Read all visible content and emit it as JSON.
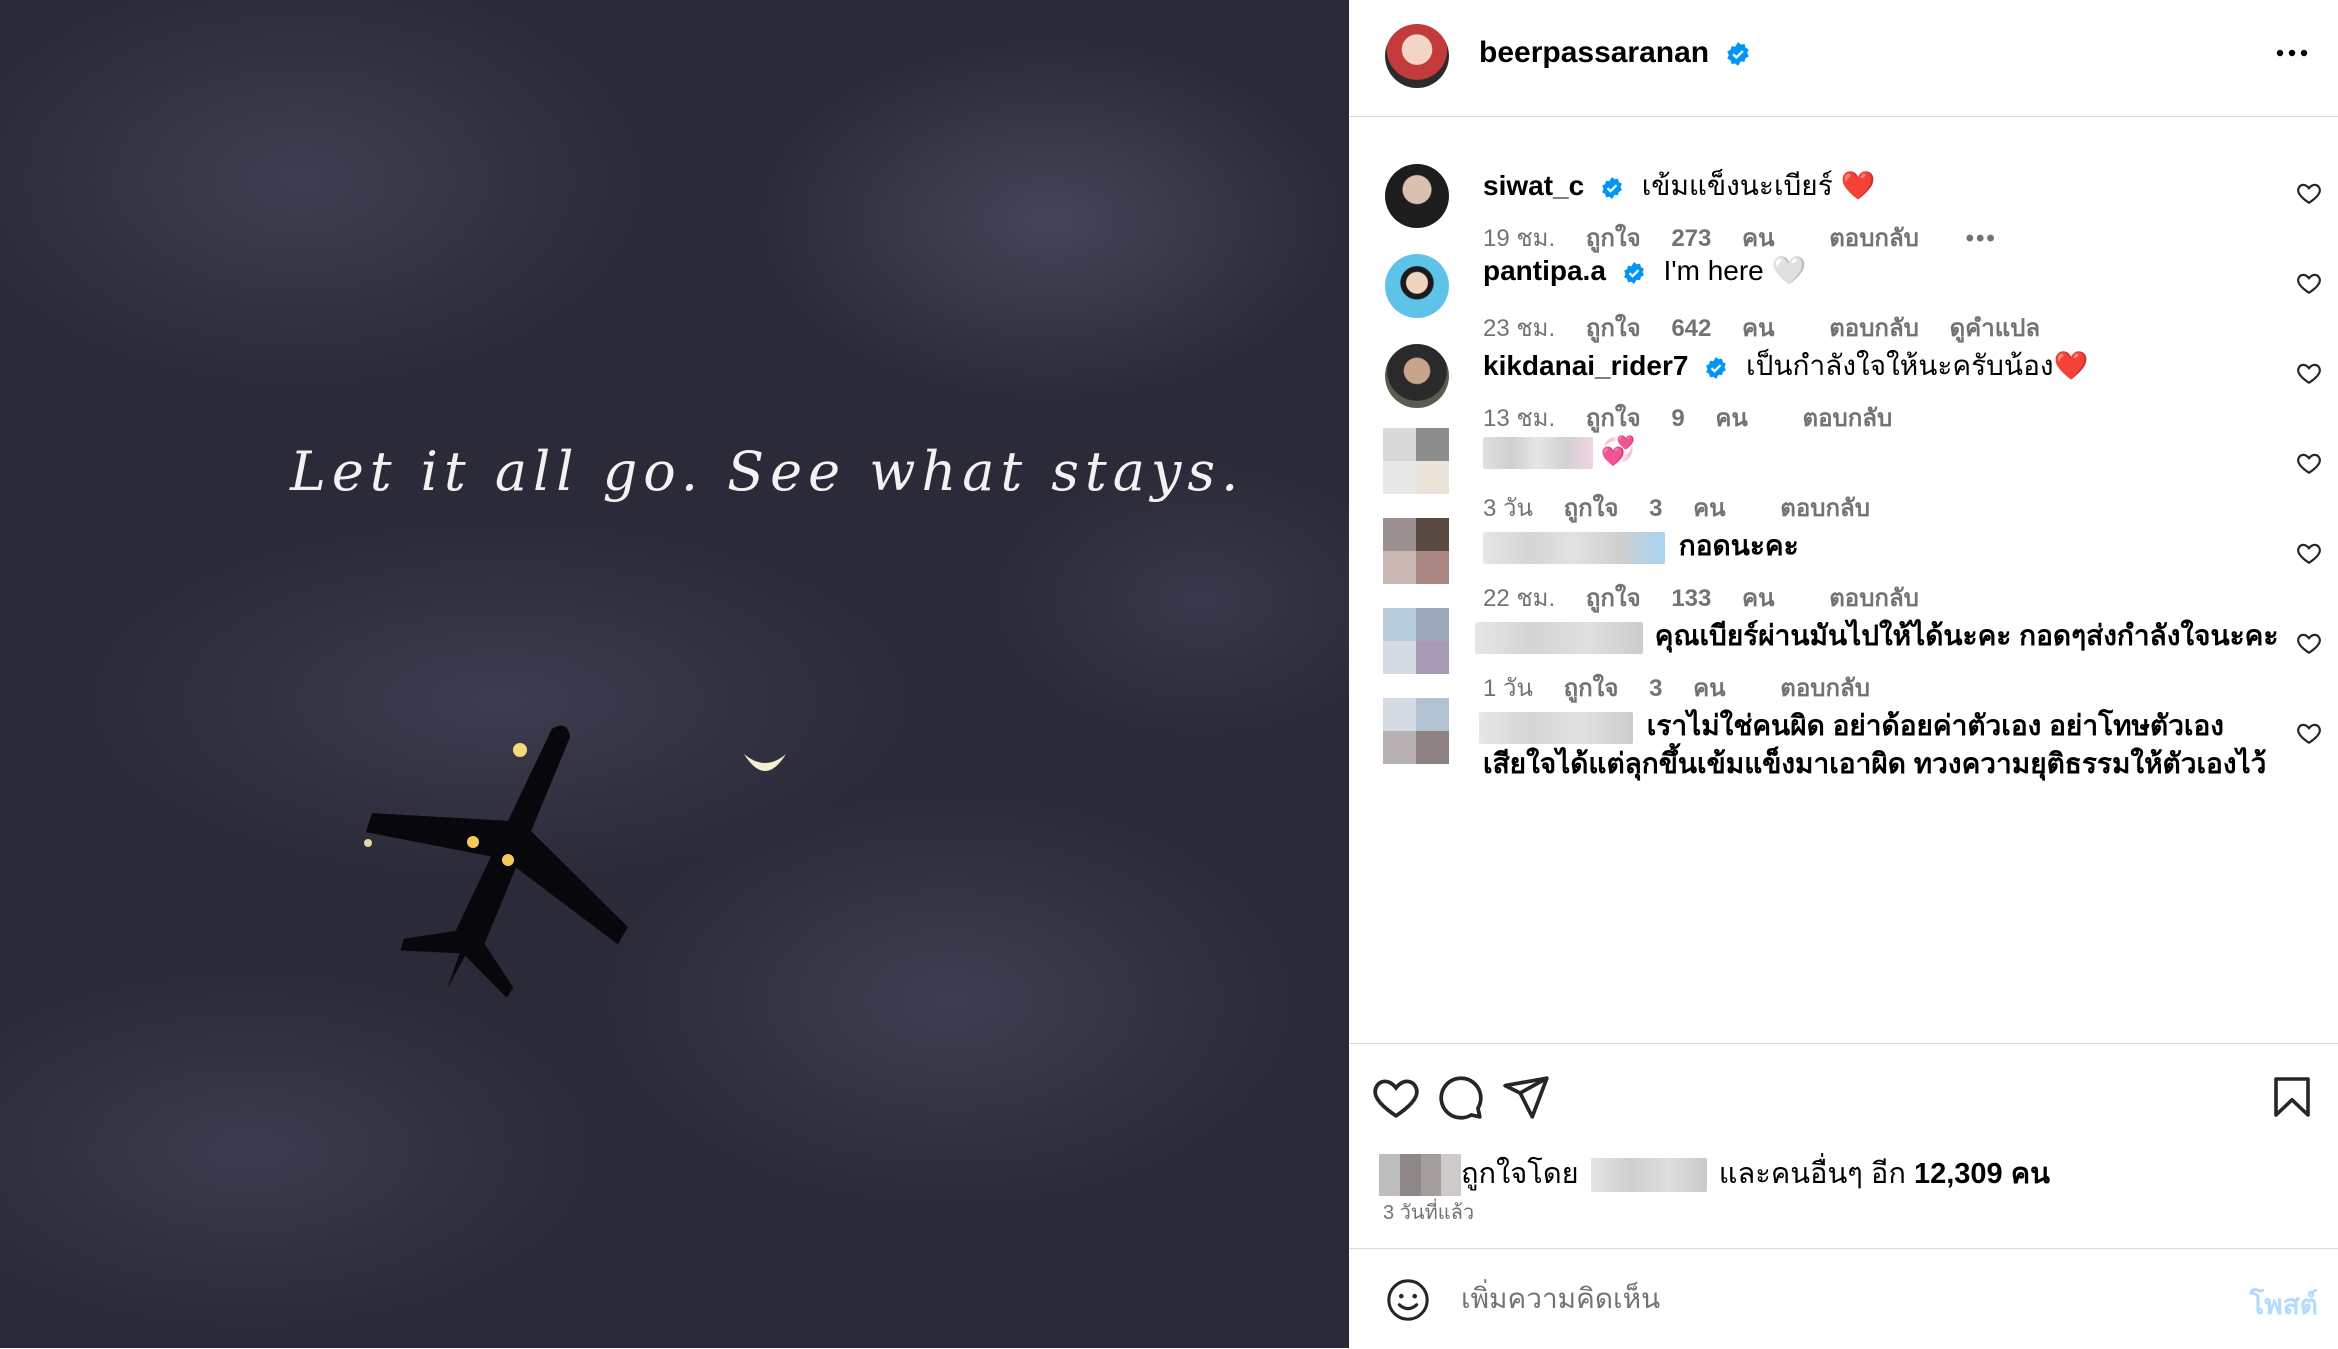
{
  "photo": {
    "caption": "Let it all go. See what stays."
  },
  "header": {
    "username": "beerpassaranan",
    "more_icon": "more-horizontal-icon"
  },
  "comments": [
    {
      "username": "siwat_c",
      "verified": true,
      "text": "เข้มแข็งนะเบียร์ ❤️",
      "time": "19 ชม.",
      "likes_prefix": "ถูกใจ",
      "likes": "273",
      "likes_suffix": "คน",
      "reply": "ตอบกลับ",
      "extra": "•••"
    },
    {
      "username": "pantipa.a",
      "verified": true,
      "text": "I'm here 🤍",
      "time": "23 ชม.",
      "likes_prefix": "ถูกใจ",
      "likes": "642",
      "likes_suffix": "คน",
      "reply": "ตอบกลับ",
      "extra": "ดูคำแปล"
    },
    {
      "username": "kikdanai_rider7",
      "verified": true,
      "text": "เป็นกำลังใจให้นะครับน้อง❤️",
      "time": "13 ชม.",
      "likes_prefix": "ถูกใจ",
      "likes": "9",
      "likes_suffix": "คน",
      "reply": "ตอบกลับ"
    },
    {
      "username": "",
      "text": "💞",
      "time": "3 วัน",
      "likes_prefix": "ถูกใจ",
      "likes": "3",
      "likes_suffix": "คน",
      "reply": "ตอบกลับ"
    },
    {
      "username": "",
      "text": "กอดนะคะ",
      "time": "22 ชม.",
      "likes_prefix": "ถูกใจ",
      "likes": "133",
      "likes_suffix": "คน",
      "reply": "ตอบกลับ"
    },
    {
      "username": "",
      "text": "คุณเบียร์ผ่านมันไปให้ได้นะคะ กอดๆส่งกำลังใจนะคะ",
      "time": "1 วัน",
      "likes_prefix": "ถูกใจ",
      "likes": "3",
      "likes_suffix": "คน",
      "reply": "ตอบกลับ"
    },
    {
      "username": "",
      "text": "เราไม่ใช่คนผิด อย่าด้อยค่าตัวเอง อย่าโทษตัวเอง",
      "text2": "เสียใจได้แต่ลุกขึ้นเข้มแข็งมาเอาผิด ทวงความยุติธรรมให้ตัวเองไว้"
    }
  ],
  "actions": {
    "like_icon": "heart-icon",
    "comment_icon": "comment-icon",
    "share_icon": "send-icon",
    "save_icon": "bookmark-icon"
  },
  "likes": {
    "prefix": "ถูกใจโดย",
    "middle": "และคนอื่นๆ อีก",
    "count": "12,309",
    "suffix": "คน"
  },
  "timestamp": "3 วันที่แล้ว",
  "add_comment": {
    "placeholder": "เพิ่มความคิดเห็น",
    "post_label": "โพสต์",
    "emoji_icon": "emoji-smile-icon"
  },
  "colors": {
    "verified": "#0095f6",
    "secondary_text": "#737373",
    "divider": "#dbdbdb",
    "post_disabled": "#b3dbff",
    "photo_bg": "#2a2a38"
  }
}
